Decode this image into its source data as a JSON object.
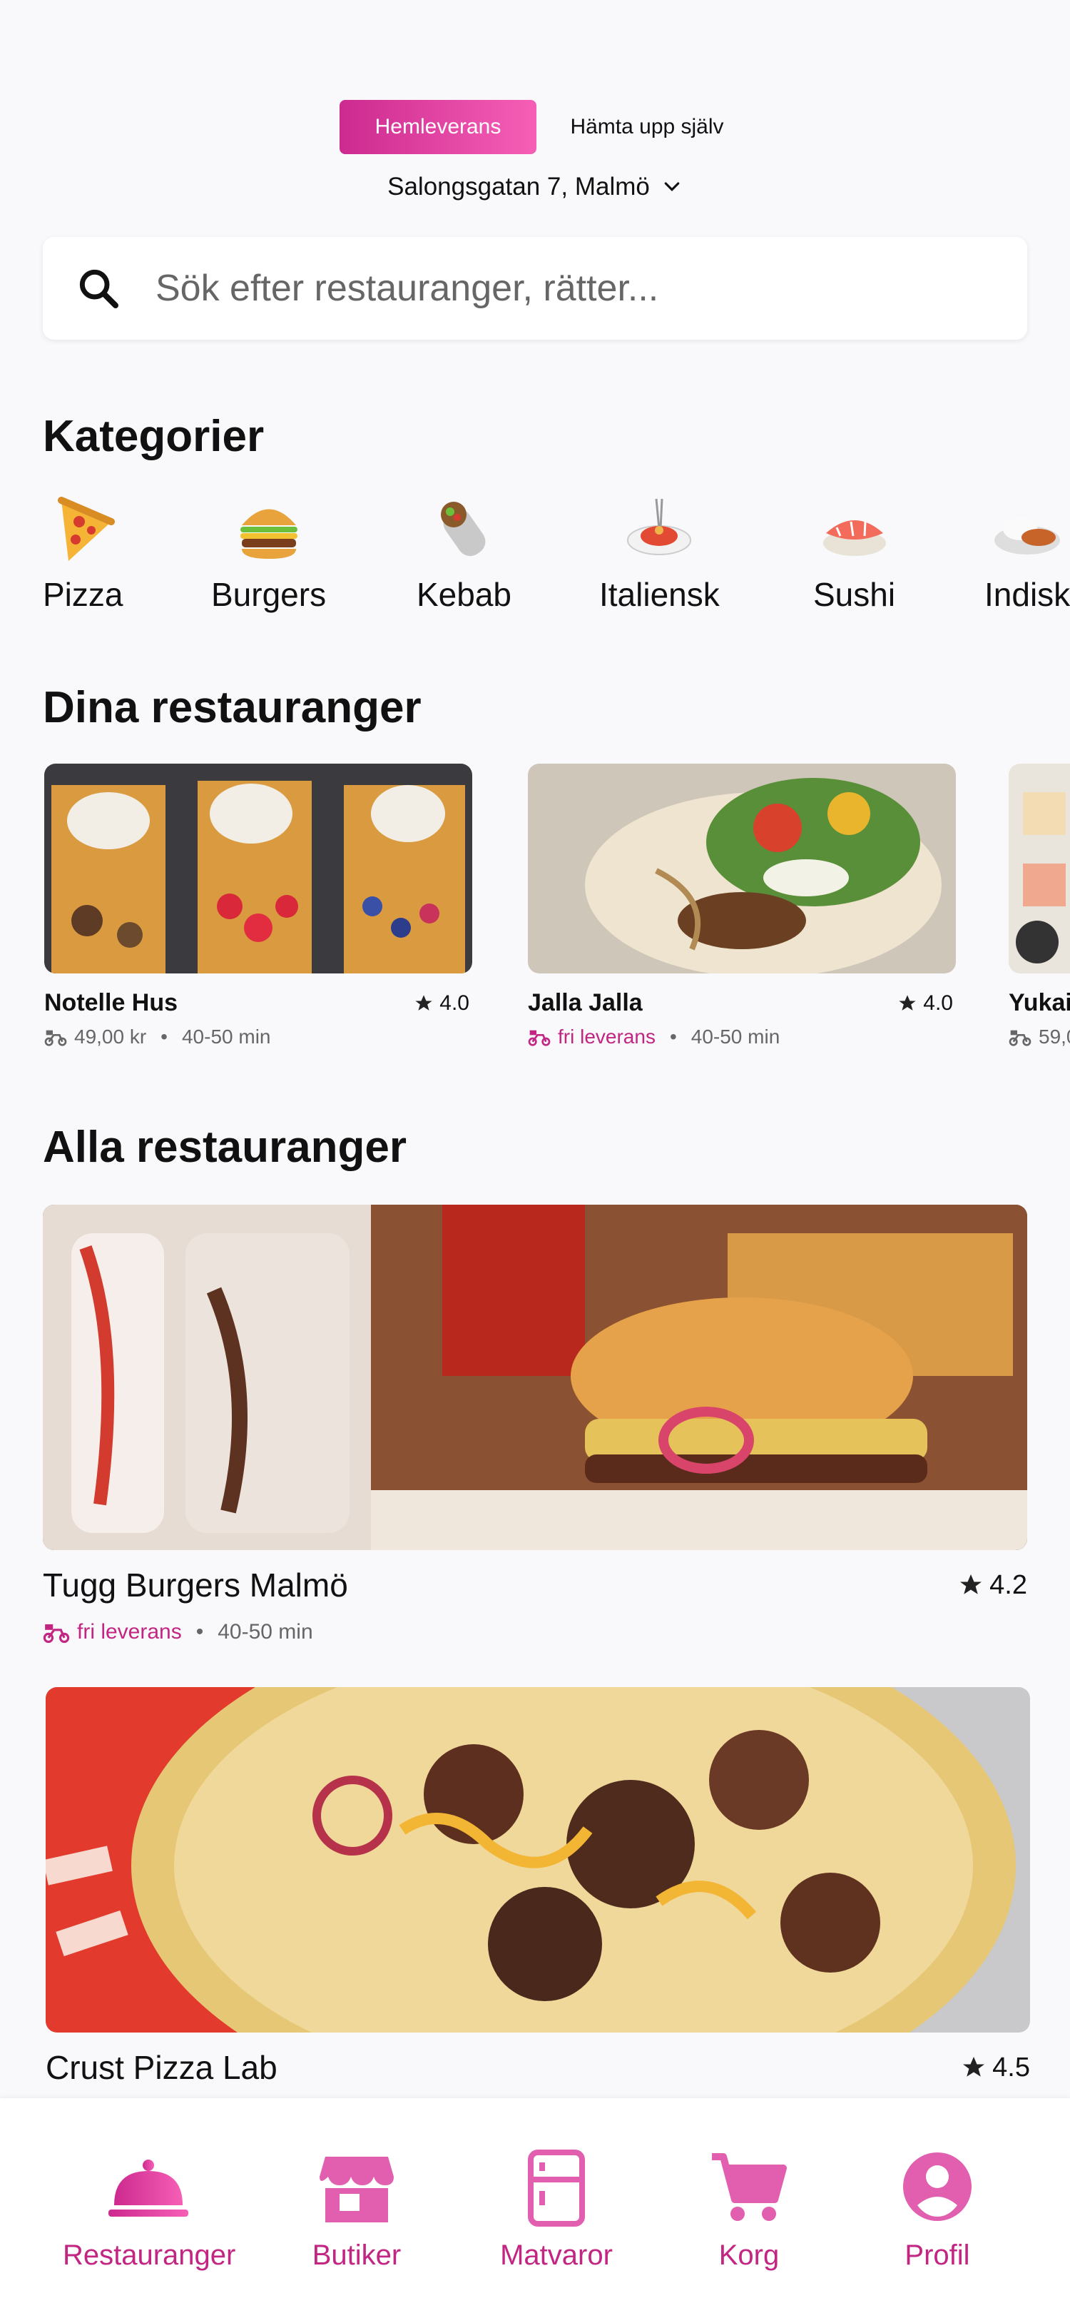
{
  "header": {
    "delivery_mode": "Hemleverans",
    "pickup_mode": "Hämta upp själv",
    "address": "Salongsgatan 7, Malmö"
  },
  "search": {
    "placeholder": "Sök efter restauranger, rätter..."
  },
  "categories": {
    "title": "Kategorier",
    "items": [
      {
        "label": "Pizza",
        "icon": "pizza-icon"
      },
      {
        "label": "Burgers",
        "icon": "burger-icon"
      },
      {
        "label": "Kebab",
        "icon": "kebab-icon"
      },
      {
        "label": "Italiensk",
        "icon": "spaghetti-icon"
      },
      {
        "label": "Sushi",
        "icon": "sushi-icon"
      },
      {
        "label": "Indisk",
        "icon": "curry-icon"
      }
    ]
  },
  "your_restaurants": {
    "title": "Dina restauranger",
    "items": [
      {
        "name": "Notelle Hus",
        "rating": "4.0",
        "delivery": "49,00 kr",
        "time": "40-50 min"
      },
      {
        "name": "Jalla Jalla",
        "rating": "4.0",
        "delivery": "fri leverans",
        "time": "40-50 min"
      },
      {
        "name": "Yukai",
        "rating": "",
        "delivery": "59,0",
        "time": ""
      }
    ]
  },
  "all_restaurants": {
    "title": "Alla restauranger",
    "items": [
      {
        "name": "Tugg Burgers Malmö",
        "rating": "4.2",
        "delivery": "fri leverans",
        "time": "40-50 min"
      },
      {
        "name": "Crust Pizza Lab",
        "rating": "4.5"
      }
    ]
  },
  "bottom_nav": {
    "items": [
      {
        "label": "Restauranger",
        "icon": "cloche-icon"
      },
      {
        "label": "Butiker",
        "icon": "store-icon"
      },
      {
        "label": "Matvaror",
        "icon": "fridge-icon"
      },
      {
        "label": "Korg",
        "icon": "cart-icon"
      },
      {
        "label": "Profil",
        "icon": "profile-icon"
      }
    ]
  },
  "colors": {
    "accent": "#c22582",
    "accent_light": "#f65fb6",
    "background": "#f9f9fb"
  },
  "separator": "•"
}
